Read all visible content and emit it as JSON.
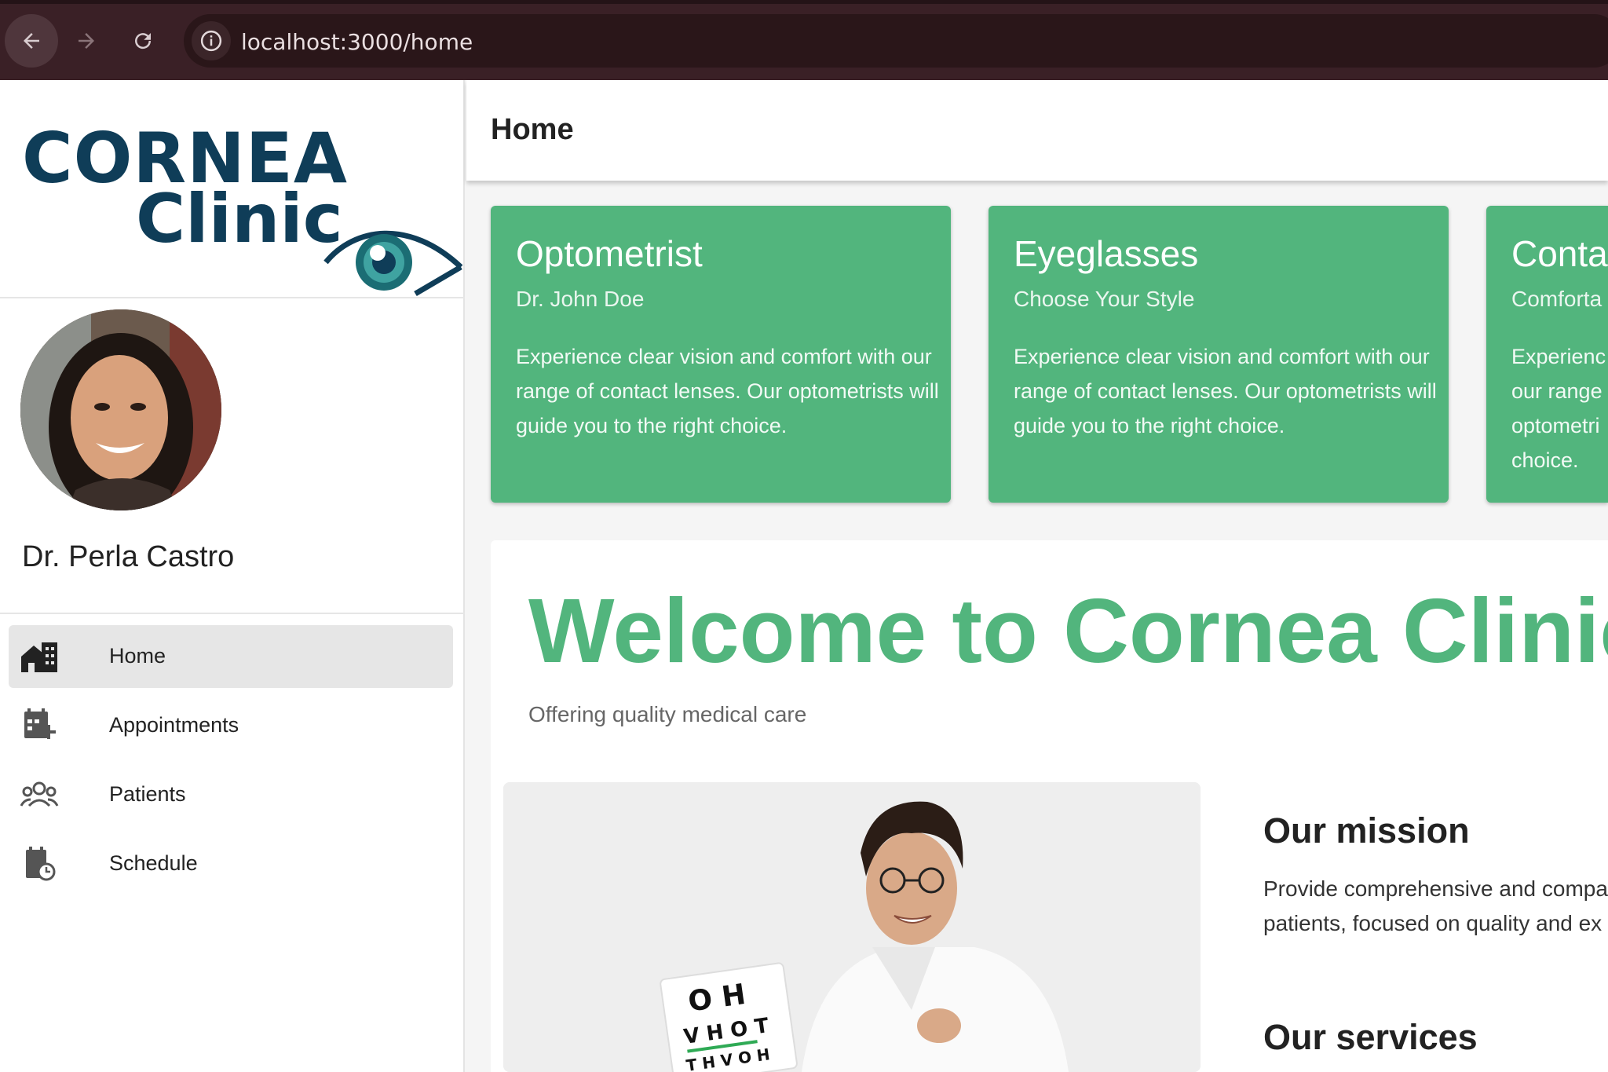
{
  "browser": {
    "url": "localhost:3000/home",
    "back_icon": "arrow-left-icon",
    "forward_icon": "arrow-right-icon",
    "reload_icon": "reload-icon",
    "info_icon": "info-icon"
  },
  "sidebar": {
    "logo": {
      "line1": "CORNEA",
      "line2": "Clinic"
    },
    "doctor_name": "Dr. Perla Castro",
    "items": [
      {
        "label": "Home",
        "icon": "home-building-icon",
        "active": true
      },
      {
        "label": "Appointments",
        "icon": "calendar-add-icon",
        "active": false
      },
      {
        "label": "Patients",
        "icon": "group-people-icon",
        "active": false
      },
      {
        "label": "Schedule",
        "icon": "calendar-clock-icon",
        "active": false
      }
    ]
  },
  "header": {
    "title": "Home"
  },
  "cards": [
    {
      "title": "Optometrist",
      "subtitle": "Dr. John Doe",
      "body": "Experience clear vision and comfort with our range of contact lenses. Our optometrists will guide you to the right choice."
    },
    {
      "title": "Eyeglasses",
      "subtitle": "Choose Your Style",
      "body": "Experience clear vision and comfort with our range of contact lenses. Our optometrists will guide you to the right choice."
    },
    {
      "title": "Conta",
      "subtitle": "Comforta",
      "body": "Experienc our range optometri choice."
    }
  ],
  "welcome": {
    "title": "Welcome to Cornea Clinic",
    "subtitle": "Offering quality medical care",
    "mission_title": "Our mission",
    "mission_line1": "Provide comprehensive and compa",
    "mission_line2": "patients, focused on quality and ex",
    "services_title": "Our services"
  },
  "colors": {
    "accent_green": "#52b57d",
    "logo_navy": "#0f3d58",
    "browser_bar": "#3a2026"
  }
}
